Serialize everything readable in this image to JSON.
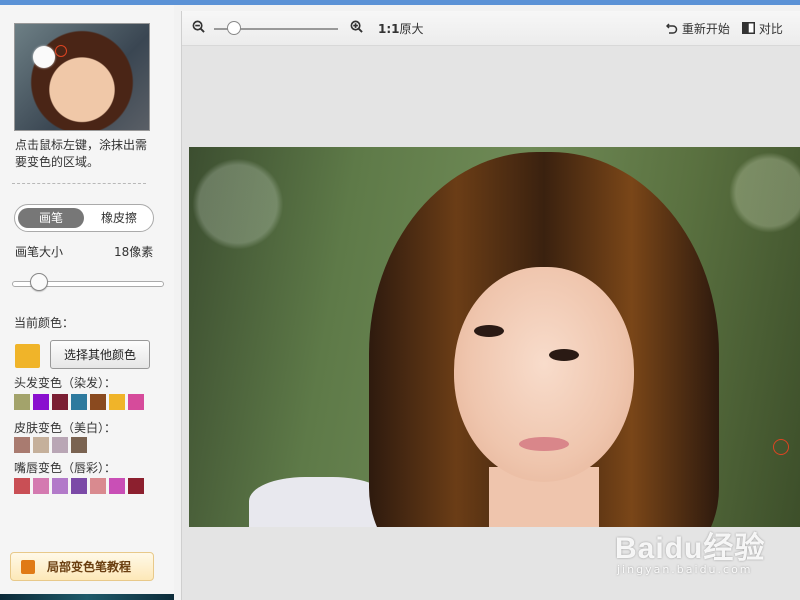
{
  "sidebar": {
    "hint": "点击鼠标左键，涂抹出需要变色的区域。",
    "mode_toggle": {
      "brush": "画笔",
      "eraser": "橡皮擦"
    },
    "brush_size": {
      "label": "画笔大小",
      "value": "18像素",
      "slider_fraction": 0.14
    },
    "current_color": {
      "label": "当前颜色：",
      "color": "#f0b429",
      "pick_button": "选择其他颜色"
    },
    "hair": {
      "label": "头发变色（染发）：",
      "colors": [
        "#a3a36b",
        "#8a0fcf",
        "#7b1e33",
        "#2d7a9e",
        "#8a4a1f",
        "#f0b429",
        "#d64b9b"
      ]
    },
    "skin": {
      "label": "皮肤变色（美白）：",
      "colors": [
        "#a97b70",
        "#c5b09b",
        "#b9a6b5",
        "#7a6351"
      ]
    },
    "lips": {
      "label": "嘴唇变色（唇彩）：",
      "colors": [
        "#c94f55",
        "#d47ab0",
        "#b27ac9",
        "#7b4aa7",
        "#d98a8f",
        "#c94fb6",
        "#8c1f2e"
      ]
    },
    "tutorial_button": "局部变色笔教程"
  },
  "toolbar": {
    "zoom_slider_fraction": 0.15,
    "actual_size_prefix": "1:1",
    "actual_size_label": "原大",
    "restart_label": "重新开始",
    "compare_label": "对比"
  },
  "watermark": {
    "brand": "Baidu经验",
    "url": "jingyan.baidu.com"
  }
}
